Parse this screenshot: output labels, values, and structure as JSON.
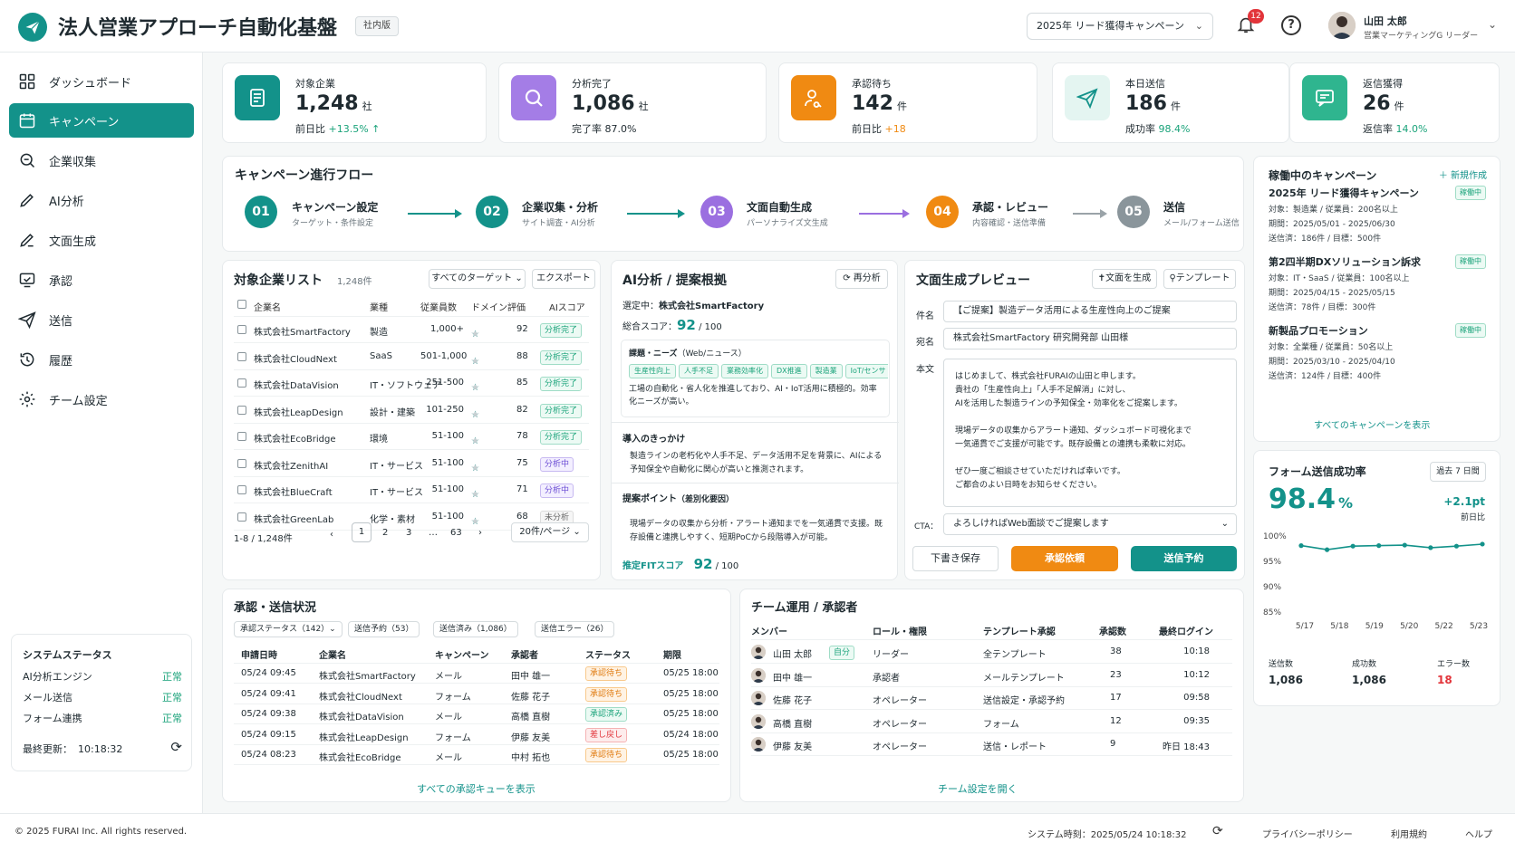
{
  "header": {
    "title": "法人営業アプローチ自動化基盤",
    "badge": "社内版",
    "campaign_select": "2025年 リード獲得キャンペーン",
    "notification_count": "12",
    "user_name": "山田 太郎",
    "user_role": "営業マーケティングG リーダー"
  },
  "sidebar": {
    "items": [
      {
        "label": "ダッシュボード",
        "icon": "grid-icon"
      },
      {
        "label": "キャンペーン",
        "icon": "calendar-icon",
        "active": true
      },
      {
        "label": "企業収集",
        "icon": "search-icon"
      },
      {
        "label": "AI分析",
        "icon": "pencil-icon"
      },
      {
        "label": "文面生成",
        "icon": "edit-icon"
      },
      {
        "label": "承認",
        "icon": "monitor-check-icon"
      },
      {
        "label": "送信",
        "icon": "send-icon"
      },
      {
        "label": "履歴",
        "icon": "history-icon"
      },
      {
        "label": "チーム設定",
        "icon": "gear-icon"
      }
    ],
    "status": {
      "title": "システムステータス",
      "rows": [
        {
          "label": "AI分析エンジン",
          "value": "正常"
        },
        {
          "label": "メール送信",
          "value": "正常"
        },
        {
          "label": "フォーム連携",
          "value": "正常"
        }
      ],
      "updated_label": "最終更新：",
      "updated_time": "10:18:32"
    }
  },
  "kpis": [
    {
      "label": "対象企業",
      "value": "1,248",
      "unit": "社",
      "sub_label": "前日比",
      "sub_value": "+13.5% ↑",
      "color": "#13928a"
    },
    {
      "label": "分析完了",
      "value": "1,086",
      "unit": "社",
      "sub_label": "完了率",
      "sub_value": "87.0%",
      "color": "#9b6fe0"
    },
    {
      "label": "承認待ち",
      "value": "142",
      "unit": "件",
      "sub_label": "前日比",
      "sub_value": "+18",
      "color": "#f08a12"
    },
    {
      "label": "本日送信",
      "value": "186",
      "unit": "件",
      "sub_label": "成功率",
      "sub_value": "98.4%",
      "color": "#13928a"
    },
    {
      "label": "返信獲得",
      "value": "26",
      "unit": "件",
      "sub_label": "返信率",
      "sub_value": "14.0%",
      "color": "#2fb58f"
    }
  ],
  "flow": {
    "title": "キャンペーン進行フロー",
    "steps": [
      {
        "num": "01",
        "title": "キャンペーン設定",
        "sub": "ターゲット・条件設定",
        "color": "#13928a"
      },
      {
        "num": "02",
        "title": "企業収集・分析",
        "sub": "サイト調査・AI分析",
        "color": "#13928a"
      },
      {
        "num": "03",
        "title": "文面自動生成",
        "sub": "パーソナライズ文生成",
        "color": "#9b6fe0"
      },
      {
        "num": "04",
        "title": "承認・レビュー",
        "sub": "内容確認・送信準備",
        "color": "#f08a12"
      },
      {
        "num": "05",
        "title": "送信",
        "sub": "メール/フォーム送信",
        "color": "#8a959b"
      }
    ]
  },
  "company_list": {
    "title": "対象企業リスト",
    "count": "1,248件",
    "filter": "すべてのターゲット ⌄",
    "export": "エクスポート",
    "headers": [
      "企業名",
      "業種",
      "従業員数",
      "ドメイン評価",
      "AIスコア"
    ],
    "rows": [
      {
        "name": "株式会社SmartFactory",
        "industry": "製造",
        "size": "1,000+",
        "stars": 3,
        "score": "92",
        "status": "分析完了",
        "kind": "done"
      },
      {
        "name": "株式会社CloudNext",
        "industry": "SaaS",
        "size": "501-1,000",
        "stars": 3,
        "score": "88",
        "status": "分析完了",
        "kind": "done"
      },
      {
        "name": "株式会社DataVision",
        "industry": "IT・ソフトウェア",
        "size": "251-500",
        "stars": 3,
        "score": "85",
        "status": "分析完了",
        "kind": "done"
      },
      {
        "name": "株式会社LeapDesign",
        "industry": "設計・建築",
        "size": "101-250",
        "stars": 3,
        "score": "82",
        "status": "分析完了",
        "kind": "done"
      },
      {
        "name": "株式会社EcoBridge",
        "industry": "環境",
        "size": "51-100",
        "stars": 3,
        "score": "78",
        "status": "分析完了",
        "kind": "done"
      },
      {
        "name": "株式会社ZenithAI",
        "industry": "IT・サービス",
        "size": "51-100",
        "stars": 3,
        "score": "75",
        "status": "分析中",
        "kind": "prog"
      },
      {
        "name": "株式会社BlueCraft",
        "industry": "IT・サービス",
        "size": "51-100",
        "stars": 3,
        "score": "71",
        "status": "分析中",
        "kind": "prog"
      },
      {
        "name": "株式会社GreenLab",
        "industry": "化学・素材",
        "size": "51-100",
        "stars": 3,
        "score": "68",
        "status": "未分析",
        "kind": "none"
      }
    ],
    "pager": {
      "range": "1-8 / 1,248件",
      "pages": [
        "1",
        "2",
        "3",
        "…",
        "63"
      ],
      "per_page": "20件/ページ ⌄"
    }
  },
  "ai": {
    "title": "AI分析 / 提案根拠",
    "reanalyze": "⟳ 再分析",
    "selected_label": "選定中：",
    "selected": "株式会社SmartFactory",
    "score_label": "総合スコア：",
    "score": "92",
    "score_max": "/ 100",
    "needs_title": "課題・ニーズ",
    "needs_sub": "（Web/ニュース）",
    "chips": [
      "生産性向上",
      "人手不足",
      "業務効率化",
      "DX推進",
      "製造業",
      "IoT/センサ"
    ],
    "needs_text": "工場の自動化・省人化を推進しており、AI・IoT活用に積極的。効率化ニーズが高い。",
    "trigger_title": "導入のきっかけ",
    "trigger_text": "製造ラインの老朽化や人手不足、データ活用不足を背景に、AIによる予知保全や自動化に関心が高いと推測されます。",
    "point_title": "提案ポイント",
    "point_sub": "（差別化要因）",
    "point_text": "現場データの収集から分析・アラート通知までを一気通貫で支援。既存設備と連携しやすく、短期PoCから段階導入が可能。",
    "fit_label": "推定FITスコア",
    "fit": "92",
    "fit_max": "/ 100"
  },
  "preview": {
    "title": "文面生成プレビュー",
    "gen_btn": "✝文面を生成",
    "tpl_btn": "⚲テンプレート",
    "subject_label": "件名",
    "subject": "【ご提案】製造データ活用による生産性向上のご提案",
    "to_label": "宛名",
    "to": "株式会社SmartFactory 研究開発部 山田様",
    "body_label": "本文",
    "body_lines": [
      "はじめまして、株式会社FURAIの山田と申します。",
      "貴社の「生産性向上」「人手不足解消」に対し、",
      "AIを活用した製造ラインの予知保全・効率化をご提案します。",
      "",
      "現場データの収集からアラート通知、ダッシュボード可視化まで",
      "一気通貫でご支援が可能です。既存設備との連携も柔軟に対応。",
      "",
      "ぜひ一度ご相談させていただければ幸いです。",
      "ご都合のよい日時をお知らせください。"
    ],
    "cta_label": "CTA：",
    "cta": "よろしければWeb面談でご提案します",
    "draft_btn": "下書き保存",
    "approve_btn": "承認依頼",
    "schedule_btn": "送信予約"
  },
  "active_campaigns": {
    "title": "稼働中のキャンペーン",
    "new_btn": "＋ 新規作成",
    "items": [
      {
        "name": "2025年 リード獲得キャンペーン",
        "badge": "稼働中",
        "target": "対象：製造業 / 従業員：200名以上",
        "period": "期間：2025/05/01 - 2025/06/30",
        "progress": "送信済：186件 / 目標：500件"
      },
      {
        "name": "第2四半期DXソリューション訴求",
        "badge": "稼働中",
        "target": "対象：IT・SaaS / 従業員：100名以上",
        "period": "期間：2025/04/15 - 2025/05/15",
        "progress": "送信済：78件 / 目標：300件"
      },
      {
        "name": "新製品プロモーション",
        "badge": "稼働中",
        "target": "対象：全業種 / 従業員：50名以上",
        "period": "期間：2025/03/10 - 2025/04/10",
        "progress": "送信済：124件 / 目標：400件"
      }
    ],
    "view_all": "すべてのキャンペーンを表示"
  },
  "form_rate": {
    "title": "フォーム送信成功率",
    "range": "過去 7 日間",
    "value": "98.4",
    "unit": "%",
    "delta": "+2.1pt",
    "delta_label": "前日比",
    "y_ticks": [
      "100%",
      "95%",
      "90%",
      "85%"
    ],
    "stats": [
      {
        "label": "送信数",
        "value": "1,086"
      },
      {
        "label": "成功数",
        "value": "1,086"
      },
      {
        "label": "エラー数",
        "value": "18"
      }
    ]
  },
  "chart_data": {
    "type": "line",
    "categories": [
      "5/17",
      "5/18",
      "5/19",
      "5/20",
      "5/22",
      "5/23"
    ],
    "x": [
      "5/17",
      "5/17",
      "5/18",
      "5/19",
      "5/20",
      "5/22",
      "5/23"
    ],
    "values": [
      98.1,
      97.3,
      98.0,
      98.1,
      98.2,
      97.7,
      98.0,
      98.4
    ],
    "ylim": [
      85,
      100
    ],
    "y_ticks": [
      100,
      95,
      90,
      85
    ],
    "grid": false
  },
  "approvals": {
    "title": "承認・送信状況",
    "filters": [
      "承認ステータス（142）⌄",
      "送信予約（53）",
      "送信済み（1,086）",
      "送信エラー（26）"
    ],
    "headers": [
      "申請日時",
      "企業名",
      "キャンペーン",
      "承認者",
      "ステータス",
      "期限"
    ],
    "rows": [
      {
        "time": "05/24 09:45",
        "company": "株式会社SmartFactory",
        "channel": "メール",
        "approver": "田中 雄一",
        "status": "承認待ち",
        "kind": "wait",
        "due": "05/25 18:00"
      },
      {
        "time": "05/24 09:41",
        "company": "株式会社CloudNext",
        "channel": "フォーム",
        "approver": "佐藤 花子",
        "status": "承認待ち",
        "kind": "wait",
        "due": "05/25 18:00"
      },
      {
        "time": "05/24 09:38",
        "company": "株式会社DataVision",
        "channel": "メール",
        "approver": "高橋 直樹",
        "status": "承認済み",
        "kind": "ok",
        "due": "05/25 18:00"
      },
      {
        "time": "05/24 09:15",
        "company": "株式会社LeapDesign",
        "channel": "フォーム",
        "approver": "伊藤 友美",
        "status": "差し戻し",
        "kind": "back",
        "due": "05/24 18:00"
      },
      {
        "time": "05/24 08:23",
        "company": "株式会社EcoBridge",
        "channel": "メール",
        "approver": "中村 拓也",
        "status": "承認待ち",
        "kind": "wait",
        "due": "05/25 18:00"
      }
    ],
    "view_all": "すべての承認キューを表示"
  },
  "team": {
    "title": "チーム運用 / 承認者",
    "headers": [
      "メンバー",
      "ロール・権限",
      "テンプレート承認",
      "承認数",
      "最終ログイン"
    ],
    "rows": [
      {
        "name": "山田 太郎",
        "self": "自分",
        "role": "リーダー",
        "tpl": "全テンプレート",
        "count": "38",
        "login": "10:18"
      },
      {
        "name": "田中 雄一",
        "self": "",
        "role": "承認者",
        "tpl": "メールテンプレート",
        "count": "23",
        "login": "10:12"
      },
      {
        "name": "佐藤 花子",
        "self": "",
        "role": "オペレーター",
        "tpl": "送信設定・承認予約",
        "count": "17",
        "login": "09:58"
      },
      {
        "name": "高橋 直樹",
        "self": "",
        "role": "オペレーター",
        "tpl": "フォーム",
        "count": "12",
        "login": "09:35"
      },
      {
        "name": "伊藤 友美",
        "self": "",
        "role": "オペレーター",
        "tpl": "送信・レポート",
        "count": "9",
        "login": "昨日 18:43"
      }
    ],
    "open_settings": "チーム設定を開く"
  },
  "footer": {
    "copyright": "© 2025 FURAI Inc. All rights reserved.",
    "system_time_label": "システム時刻：",
    "system_time": "2025/05/24 10:18:32",
    "privacy": "プライバシーポリシー",
    "terms": "利用規約",
    "help": "ヘルプ"
  },
  "colors": {
    "primary": "#13928a",
    "purple": "#9b6fe0",
    "orange": "#f08a12",
    "danger": "#e2343a"
  }
}
